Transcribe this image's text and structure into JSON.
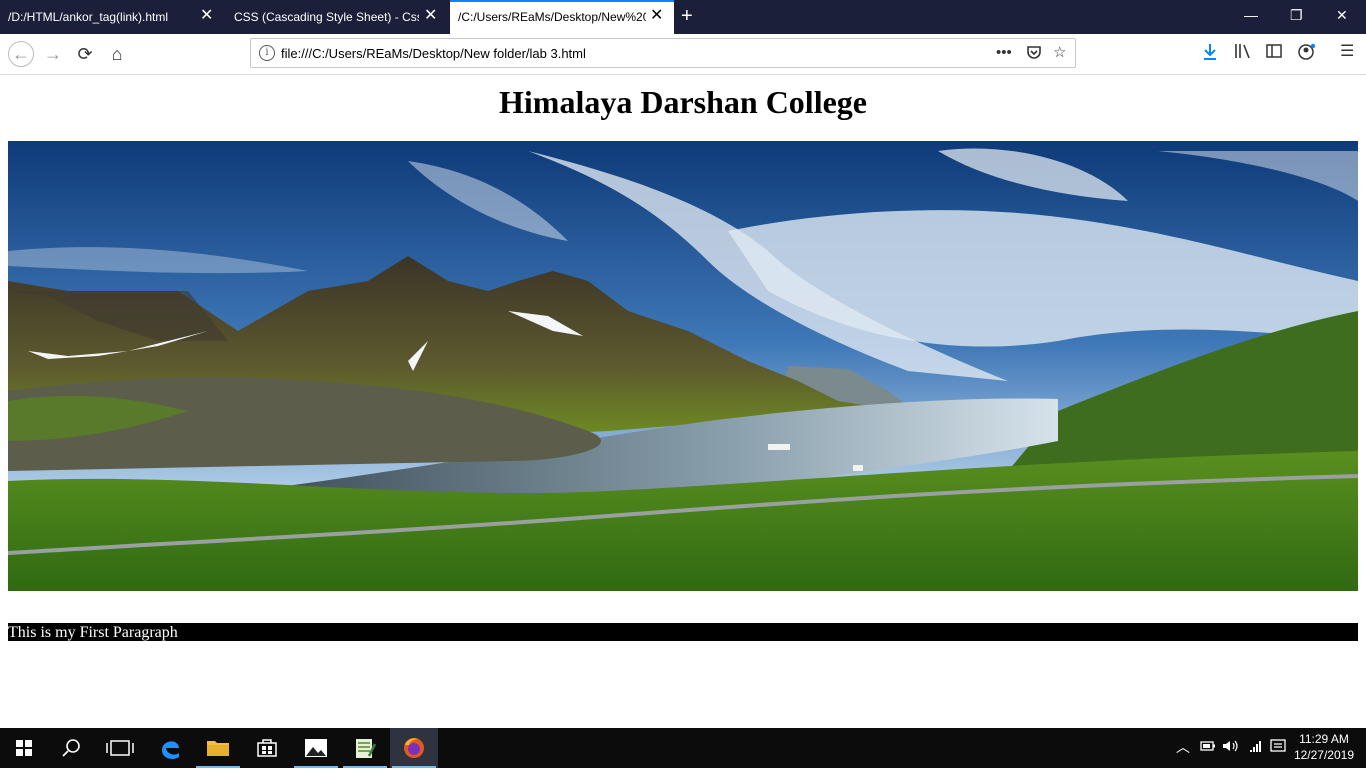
{
  "browser": {
    "tabs": [
      {
        "title": "/D:/HTML/ankor_tag(link).html",
        "active": false
      },
      {
        "title": "CSS (Cascading Style Sheet) - Css.p",
        "active": false
      },
      {
        "title": "/C:/Users/REaMs/Desktop/New%20",
        "active": true
      }
    ],
    "url": "file:///C:/Users/REaMs/Desktop/New folder/lab 3.html"
  },
  "page": {
    "heading": "Himalaya Darshan College",
    "paragraph": "This is my First Paragraph"
  },
  "taskbar": {
    "time": "11:29 AM",
    "date": "12/27/2019"
  },
  "colors": {
    "tab_strip": "#1b1f3a",
    "tab_accent": "#0a84ff",
    "taskbar": "#0c0c0c",
    "paragraph_bg": "#000000",
    "download_icon": "#0a84ff"
  }
}
